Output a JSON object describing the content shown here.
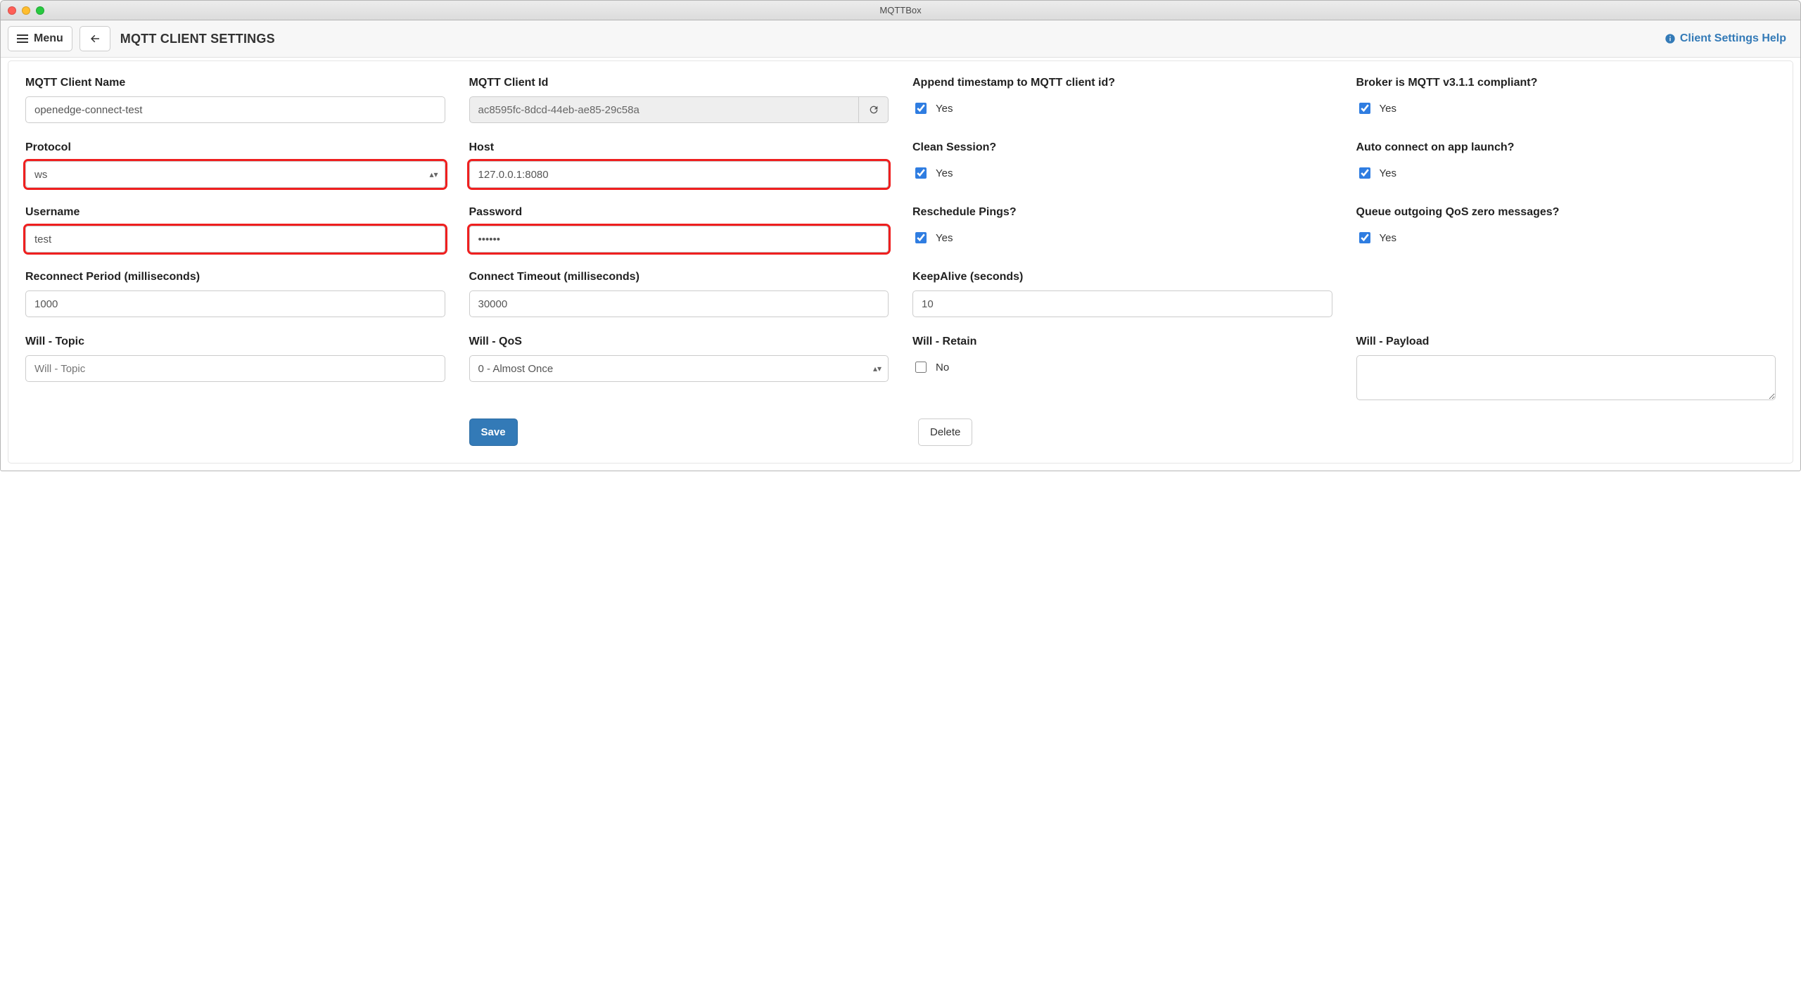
{
  "window": {
    "title": "MQTTBox"
  },
  "toolbar": {
    "menu_label": "Menu",
    "page_title": "MQTT CLIENT SETTINGS",
    "help_label": "Client Settings Help"
  },
  "fields": {
    "client_name": {
      "label": "MQTT Client Name",
      "value": "openedge-connect-test"
    },
    "client_id": {
      "label": "MQTT Client Id",
      "value": "ac8595fc-8dcd-44eb-ae85-29c58a"
    },
    "append_ts": {
      "label": "Append timestamp to MQTT client id?",
      "yes": "Yes",
      "checked": true
    },
    "broker311": {
      "label": "Broker is MQTT v3.1.1 compliant?",
      "yes": "Yes",
      "checked": true
    },
    "protocol": {
      "label": "Protocol",
      "value": "ws"
    },
    "host": {
      "label": "Host",
      "value": "127.0.0.1:8080"
    },
    "clean": {
      "label": "Clean Session?",
      "yes": "Yes",
      "checked": true
    },
    "autoconnect": {
      "label": "Auto connect on app launch?",
      "yes": "Yes",
      "checked": true
    },
    "username": {
      "label": "Username",
      "value": "test"
    },
    "password": {
      "label": "Password",
      "value": "••••••"
    },
    "resched": {
      "label": "Reschedule Pings?",
      "yes": "Yes",
      "checked": true
    },
    "queueqos0": {
      "label": "Queue outgoing QoS zero messages?",
      "yes": "Yes",
      "checked": true
    },
    "reconnect": {
      "label": "Reconnect Period (milliseconds)",
      "value": "1000"
    },
    "timeout": {
      "label": "Connect Timeout (milliseconds)",
      "value": "30000"
    },
    "keepalive": {
      "label": "KeepAlive (seconds)",
      "value": "10"
    },
    "will_topic": {
      "label": "Will - Topic",
      "placeholder": "Will - Topic",
      "value": ""
    },
    "will_qos": {
      "label": "Will - QoS",
      "value": "0 - Almost Once"
    },
    "will_retain": {
      "label": "Will - Retain",
      "no": "No",
      "checked": false
    },
    "will_payload": {
      "label": "Will - Payload",
      "value": ""
    }
  },
  "actions": {
    "save": "Save",
    "delete": "Delete"
  }
}
